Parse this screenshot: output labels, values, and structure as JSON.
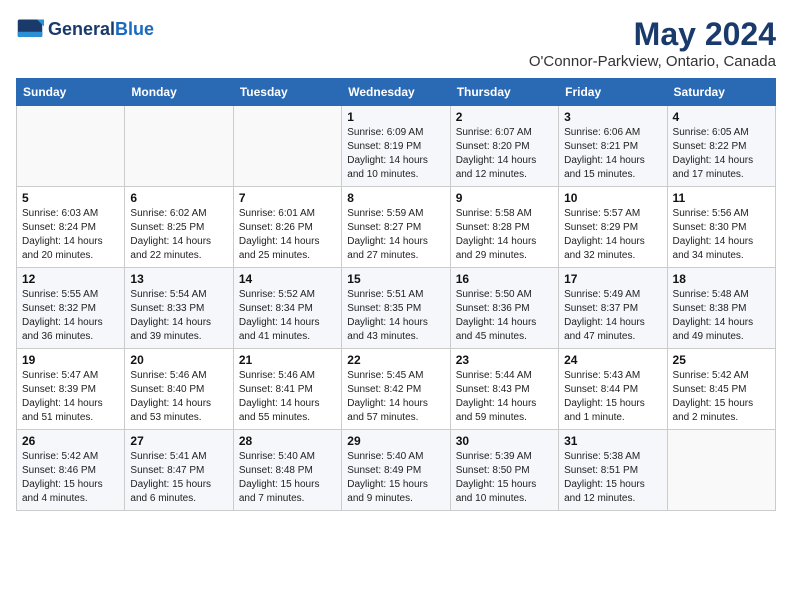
{
  "header": {
    "logo_line1": "General",
    "logo_line2": "Blue",
    "month": "May 2024",
    "location": "O'Connor-Parkview, Ontario, Canada"
  },
  "days_of_week": [
    "Sunday",
    "Monday",
    "Tuesday",
    "Wednesday",
    "Thursday",
    "Friday",
    "Saturday"
  ],
  "weeks": [
    [
      {
        "day": "",
        "info": ""
      },
      {
        "day": "",
        "info": ""
      },
      {
        "day": "",
        "info": ""
      },
      {
        "day": "1",
        "info": "Sunrise: 6:09 AM\nSunset: 8:19 PM\nDaylight: 14 hours\nand 10 minutes."
      },
      {
        "day": "2",
        "info": "Sunrise: 6:07 AM\nSunset: 8:20 PM\nDaylight: 14 hours\nand 12 minutes."
      },
      {
        "day": "3",
        "info": "Sunrise: 6:06 AM\nSunset: 8:21 PM\nDaylight: 14 hours\nand 15 minutes."
      },
      {
        "day": "4",
        "info": "Sunrise: 6:05 AM\nSunset: 8:22 PM\nDaylight: 14 hours\nand 17 minutes."
      }
    ],
    [
      {
        "day": "5",
        "info": "Sunrise: 6:03 AM\nSunset: 8:24 PM\nDaylight: 14 hours\nand 20 minutes."
      },
      {
        "day": "6",
        "info": "Sunrise: 6:02 AM\nSunset: 8:25 PM\nDaylight: 14 hours\nand 22 minutes."
      },
      {
        "day": "7",
        "info": "Sunrise: 6:01 AM\nSunset: 8:26 PM\nDaylight: 14 hours\nand 25 minutes."
      },
      {
        "day": "8",
        "info": "Sunrise: 5:59 AM\nSunset: 8:27 PM\nDaylight: 14 hours\nand 27 minutes."
      },
      {
        "day": "9",
        "info": "Sunrise: 5:58 AM\nSunset: 8:28 PM\nDaylight: 14 hours\nand 29 minutes."
      },
      {
        "day": "10",
        "info": "Sunrise: 5:57 AM\nSunset: 8:29 PM\nDaylight: 14 hours\nand 32 minutes."
      },
      {
        "day": "11",
        "info": "Sunrise: 5:56 AM\nSunset: 8:30 PM\nDaylight: 14 hours\nand 34 minutes."
      }
    ],
    [
      {
        "day": "12",
        "info": "Sunrise: 5:55 AM\nSunset: 8:32 PM\nDaylight: 14 hours\nand 36 minutes."
      },
      {
        "day": "13",
        "info": "Sunrise: 5:54 AM\nSunset: 8:33 PM\nDaylight: 14 hours\nand 39 minutes."
      },
      {
        "day": "14",
        "info": "Sunrise: 5:52 AM\nSunset: 8:34 PM\nDaylight: 14 hours\nand 41 minutes."
      },
      {
        "day": "15",
        "info": "Sunrise: 5:51 AM\nSunset: 8:35 PM\nDaylight: 14 hours\nand 43 minutes."
      },
      {
        "day": "16",
        "info": "Sunrise: 5:50 AM\nSunset: 8:36 PM\nDaylight: 14 hours\nand 45 minutes."
      },
      {
        "day": "17",
        "info": "Sunrise: 5:49 AM\nSunset: 8:37 PM\nDaylight: 14 hours\nand 47 minutes."
      },
      {
        "day": "18",
        "info": "Sunrise: 5:48 AM\nSunset: 8:38 PM\nDaylight: 14 hours\nand 49 minutes."
      }
    ],
    [
      {
        "day": "19",
        "info": "Sunrise: 5:47 AM\nSunset: 8:39 PM\nDaylight: 14 hours\nand 51 minutes."
      },
      {
        "day": "20",
        "info": "Sunrise: 5:46 AM\nSunset: 8:40 PM\nDaylight: 14 hours\nand 53 minutes."
      },
      {
        "day": "21",
        "info": "Sunrise: 5:46 AM\nSunset: 8:41 PM\nDaylight: 14 hours\nand 55 minutes."
      },
      {
        "day": "22",
        "info": "Sunrise: 5:45 AM\nSunset: 8:42 PM\nDaylight: 14 hours\nand 57 minutes."
      },
      {
        "day": "23",
        "info": "Sunrise: 5:44 AM\nSunset: 8:43 PM\nDaylight: 14 hours\nand 59 minutes."
      },
      {
        "day": "24",
        "info": "Sunrise: 5:43 AM\nSunset: 8:44 PM\nDaylight: 15 hours\nand 1 minute."
      },
      {
        "day": "25",
        "info": "Sunrise: 5:42 AM\nSunset: 8:45 PM\nDaylight: 15 hours\nand 2 minutes."
      }
    ],
    [
      {
        "day": "26",
        "info": "Sunrise: 5:42 AM\nSunset: 8:46 PM\nDaylight: 15 hours\nand 4 minutes."
      },
      {
        "day": "27",
        "info": "Sunrise: 5:41 AM\nSunset: 8:47 PM\nDaylight: 15 hours\nand 6 minutes."
      },
      {
        "day": "28",
        "info": "Sunrise: 5:40 AM\nSunset: 8:48 PM\nDaylight: 15 hours\nand 7 minutes."
      },
      {
        "day": "29",
        "info": "Sunrise: 5:40 AM\nSunset: 8:49 PM\nDaylight: 15 hours\nand 9 minutes."
      },
      {
        "day": "30",
        "info": "Sunrise: 5:39 AM\nSunset: 8:50 PM\nDaylight: 15 hours\nand 10 minutes."
      },
      {
        "day": "31",
        "info": "Sunrise: 5:38 AM\nSunset: 8:51 PM\nDaylight: 15 hours\nand 12 minutes."
      },
      {
        "day": "",
        "info": ""
      }
    ]
  ]
}
